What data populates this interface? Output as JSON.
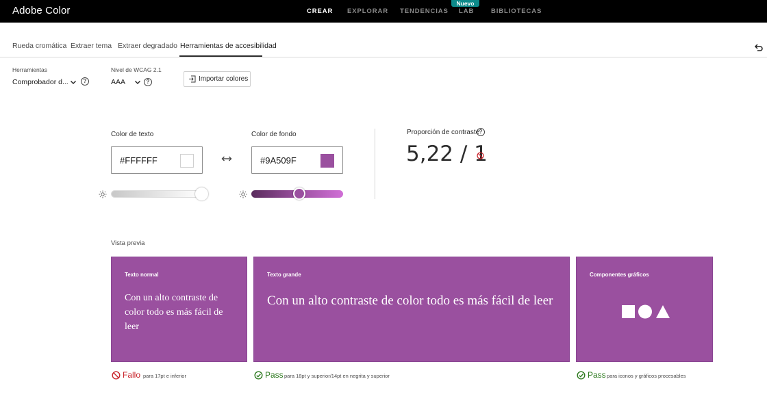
{
  "header": {
    "brand": "Adobe Color",
    "nav": [
      "CREAR",
      "EXPLORAR",
      "TENDENCIAS",
      "LAB",
      "BIBLIOTECAS"
    ],
    "badge": "Nuevo"
  },
  "tabs": [
    "Rueda cromática",
    "Extraer tema",
    "Extraer degradado",
    "Herramientas de accesibilidad"
  ],
  "controls": {
    "tools_label": "Herramientas",
    "tools_value": "Comprobador d...",
    "wcag_label": "Nivel de WCAG 2.1",
    "wcag_value": "AAA",
    "import_label": "Importar colores"
  },
  "colors": {
    "text_label": "Color de texto",
    "text_hex": "#FFFFFF",
    "bg_label": "Color de fondo",
    "bg_hex": "#9A509F",
    "text_color": "#FFFFFF",
    "bg_color": "#9A509F",
    "text_slider_level": 1.0,
    "bg_slider_level": 0.52
  },
  "contrast": {
    "label": "Proporción de contraste",
    "value": "5,22 / 1"
  },
  "preview": {
    "title": "Vista previa",
    "cards": [
      {
        "title": "Texto normal",
        "text": "Con un alto contraste de color todo es más fácil de leer"
      },
      {
        "title": "Texto grande",
        "text": "Con un alto contraste de color todo es más fácil de leer"
      },
      {
        "title": "Componentes gráficos"
      }
    ],
    "results": [
      {
        "status": "Fallo",
        "desc": "para 17pt e inferior"
      },
      {
        "status": "Pass",
        "desc": "para 18pt y superior/14pt en negrita y superior"
      },
      {
        "status": "Pass",
        "desc": "para iconos y gráficos procesables"
      }
    ]
  },
  "theme": {
    "fail_color": "#C9252C",
    "pass_color": "#2D7A1F"
  }
}
